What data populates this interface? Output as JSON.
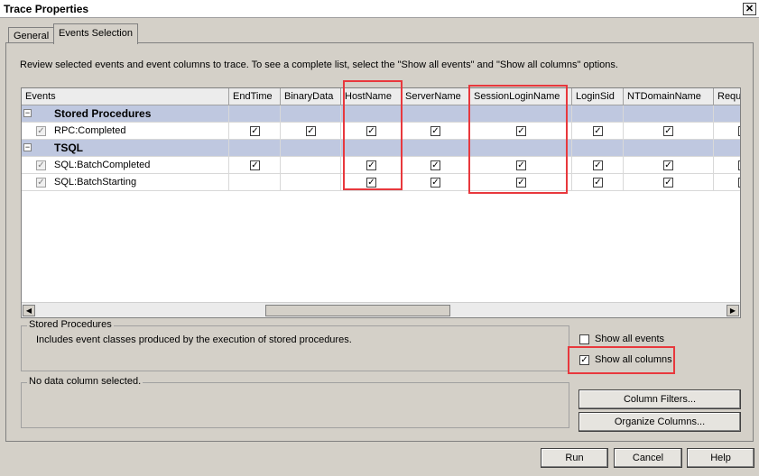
{
  "window": {
    "title": "Trace Properties",
    "close_glyph": "✕"
  },
  "tabs": [
    {
      "label": "General"
    },
    {
      "label": "Events Selection"
    }
  ],
  "instructions": "Review selected events and event columns to trace. To see a complete list, select the \"Show all events\" and \"Show all columns\" options.",
  "grid": {
    "columns": [
      "Events",
      "EndTime",
      "BinaryData",
      "HostName",
      "ServerName",
      "SessionLoginName",
      "LoginSid",
      "NTDomainName",
      "Requ"
    ],
    "rows": [
      {
        "label": "Stored Procedures",
        "type": "category",
        "expander": "−",
        "checks": [
          false,
          false,
          false,
          false,
          false,
          false,
          false,
          false
        ]
      },
      {
        "label": "RPC:Completed",
        "type": "event",
        "checks": [
          true,
          true,
          true,
          true,
          true,
          true,
          true,
          true
        ]
      },
      {
        "label": "TSQL",
        "type": "category",
        "expander": "−",
        "checks": [
          false,
          false,
          false,
          false,
          false,
          false,
          false,
          false
        ]
      },
      {
        "label": "SQL:BatchCompleted",
        "type": "event",
        "checks": [
          true,
          false,
          true,
          true,
          true,
          true,
          true,
          true
        ]
      },
      {
        "label": "SQL:BatchStarting",
        "type": "event",
        "checks": [
          false,
          false,
          true,
          true,
          true,
          true,
          true,
          true
        ]
      }
    ],
    "check_glyph": "✓",
    "scroll_left_glyph": "◀",
    "scroll_right_glyph": "▶"
  },
  "description_box": {
    "title": "Stored Procedures",
    "text": "Includes event classes produced by the execution of stored procedures."
  },
  "column_box": {
    "title": "No data column selected."
  },
  "options": {
    "show_all_events": {
      "label": "Show all events",
      "checked": false
    },
    "show_all_columns": {
      "label": "Show all columns",
      "checked": true
    }
  },
  "buttons": {
    "column_filters": "Column Filters...",
    "organize_columns": "Organize Columns...",
    "run": "Run",
    "cancel": "Cancel",
    "help": "Help"
  },
  "colors": {
    "highlight": "#e8383d",
    "category_row": "#bfc8e0"
  }
}
